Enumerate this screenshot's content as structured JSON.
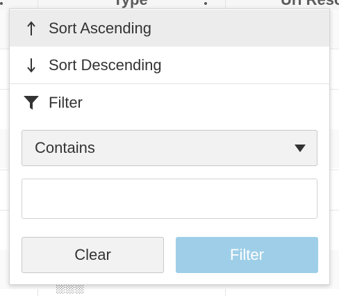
{
  "grid": {
    "header_left_text": "",
    "header_mid_text": "Type",
    "header_right_text": "Url Resource",
    "cell_peek_text": "░░░"
  },
  "menu": {
    "sort_ascending": {
      "icon": "arrow-up-icon",
      "label": "Sort Ascending"
    },
    "sort_descending": {
      "icon": "arrow-down-icon",
      "label": "Sort Descending"
    },
    "filter_title": {
      "icon": "funnel-icon",
      "label": "Filter"
    }
  },
  "filter": {
    "operator_selected": "Contains",
    "value": "",
    "placeholder": "",
    "clear_label": "Clear",
    "apply_label": "Filter"
  },
  "colors": {
    "hover_bg": "#ececec",
    "filter_button_bg": "#9fcfe8",
    "text": "#333333"
  }
}
